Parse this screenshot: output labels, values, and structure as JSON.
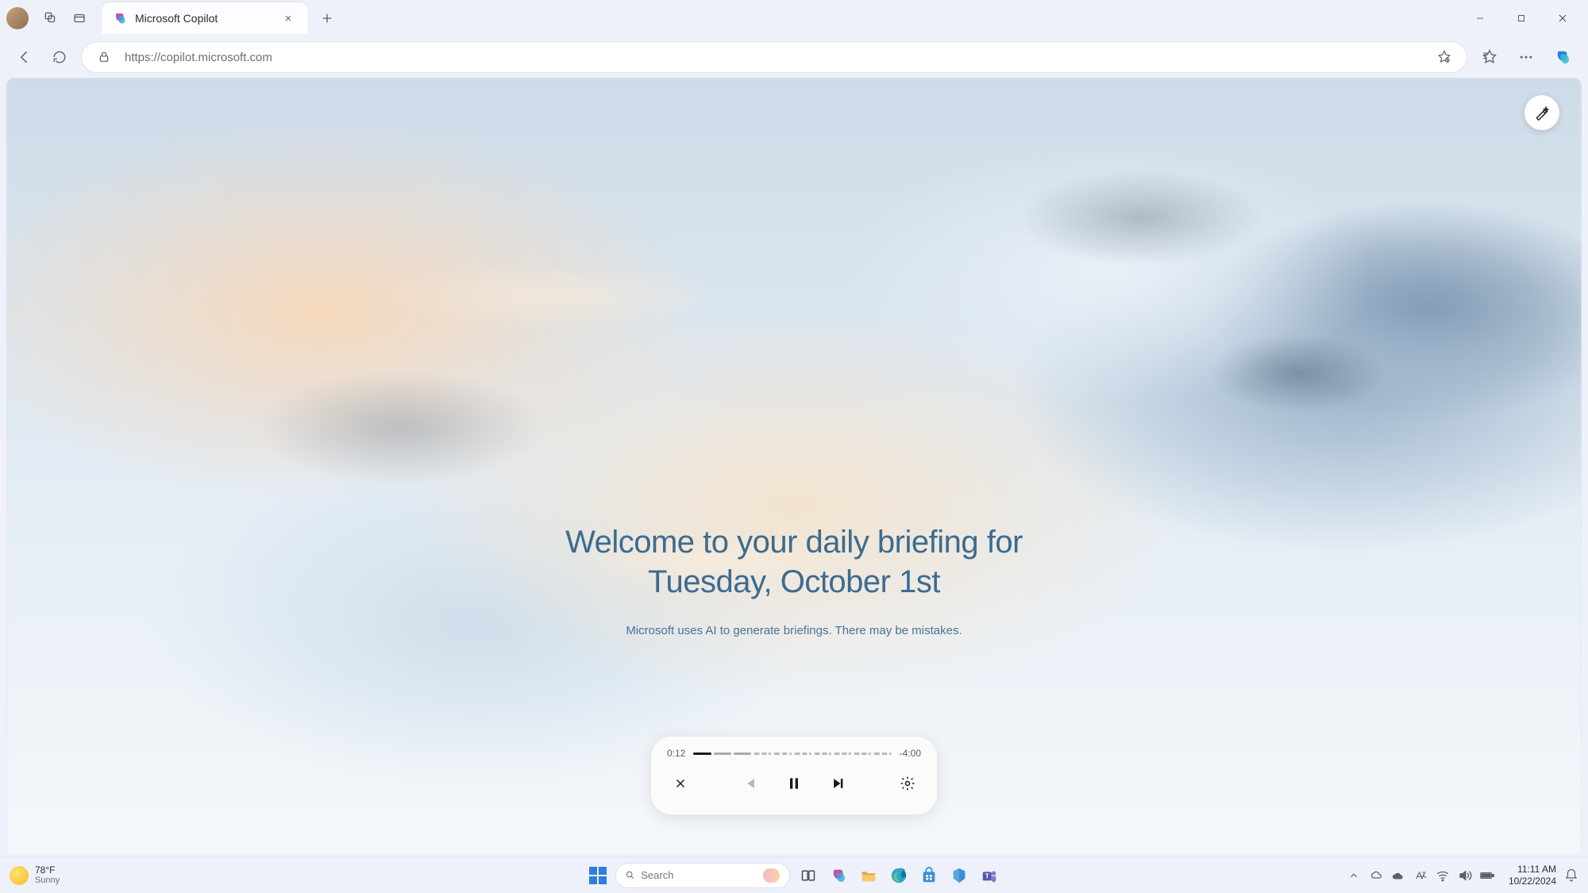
{
  "browser": {
    "tab_title": "Microsoft Copilot",
    "url": "https://copilot.microsoft.com"
  },
  "page": {
    "title_line1": "Welcome to your daily briefing for",
    "title_line2": "Tuesday, October 1st",
    "disclaimer": "Microsoft uses AI to generate briefings. There may be mistakes."
  },
  "player": {
    "elapsed": "0:12",
    "remaining": "-4:00"
  },
  "taskbar": {
    "weather_temp": "78°F",
    "weather_cond": "Sunny",
    "search_placeholder": "Search",
    "time": "11:11 AM",
    "date": "10/22/2024"
  }
}
